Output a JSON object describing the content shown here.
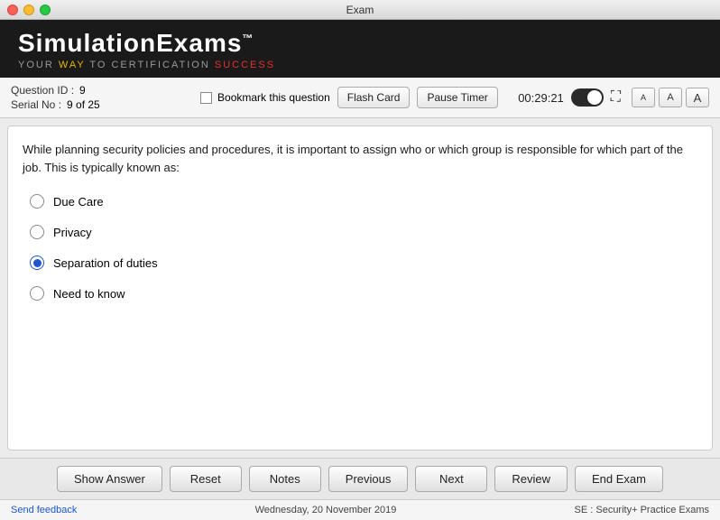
{
  "titleBar": {
    "title": "Exam"
  },
  "brand": {
    "title": "SimulationExams",
    "tm": "™",
    "subtitle": {
      "your": "YOUR",
      "way": "WAY",
      "to": "TO CERTIFICATION",
      "success": "SUCCESS"
    }
  },
  "questionInfo": {
    "questionIdLabel": "Question ID :",
    "questionIdValue": "9",
    "serialNoLabel": "Serial No :",
    "serialNoValue": "9 of 25",
    "bookmarkLabel": "Bookmark this question",
    "flashCardLabel": "Flash Card",
    "pauseTimerLabel": "Pause Timer",
    "timer": "00:29:21",
    "fontBtns": [
      "A",
      "A",
      "A"
    ]
  },
  "question": {
    "text": "While planning security policies and procedures, it is important to assign who or which group is responsible for which part of the job. This is typically known as:",
    "options": [
      {
        "id": "a",
        "label": "Due Care",
        "selected": false
      },
      {
        "id": "b",
        "label": "Privacy",
        "selected": false
      },
      {
        "id": "c",
        "label": "Separation of duties",
        "selected": true
      },
      {
        "id": "d",
        "label": "Need to know",
        "selected": false
      }
    ]
  },
  "actions": {
    "showAnswer": "Show Answer",
    "reset": "Reset",
    "notes": "Notes",
    "previous": "Previous",
    "next": "Next",
    "review": "Review",
    "endExam": "End Exam"
  },
  "footer": {
    "feedback": "Send feedback",
    "date": "Wednesday, 20 November 2019",
    "product": "SE : Security+ Practice Exams"
  }
}
